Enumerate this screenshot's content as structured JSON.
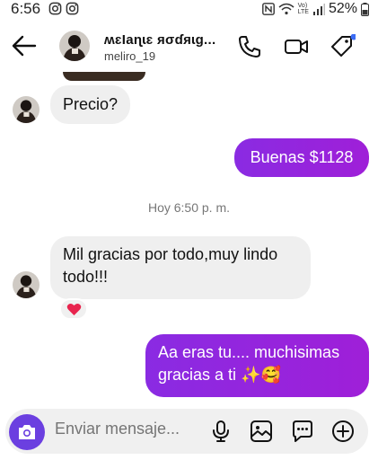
{
  "status_bar": {
    "time": "6:56",
    "battery": "52%",
    "network_label_top": "Vo)",
    "network_label_bottom": "LTE"
  },
  "header": {
    "contact_name": "ʍɛƖaɳɩɛ яσɗяɩg...",
    "username": "meliro_19"
  },
  "messages": [
    {
      "direction": "incoming",
      "text": "Precio?"
    },
    {
      "direction": "outgoing",
      "text": "Buenas $1128"
    },
    {
      "direction": "incoming",
      "line1": "Mil gracias por todo,muy lindo",
      "line2": "todo!!!",
      "reaction": "heart"
    },
    {
      "direction": "outgoing",
      "line1": "Aa eras tu.... muchisimas",
      "line2": "gracias a ti ✨🥰"
    }
  ],
  "timestamp": "Hoy 6:50 p. m.",
  "composer": {
    "placeholder": "Enviar mensaje..."
  },
  "colors": {
    "outgoing_bubble": "#9a23dc",
    "incoming_bubble": "#efefef",
    "camera_button": "#6b3fe0",
    "badge_dot": "#3b6cf5"
  },
  "icons": [
    "back-arrow-icon",
    "phone-icon",
    "video-camera-icon",
    "tag-icon",
    "camera-icon",
    "microphone-icon",
    "gallery-icon",
    "sticker-icon",
    "plus-icon"
  ]
}
